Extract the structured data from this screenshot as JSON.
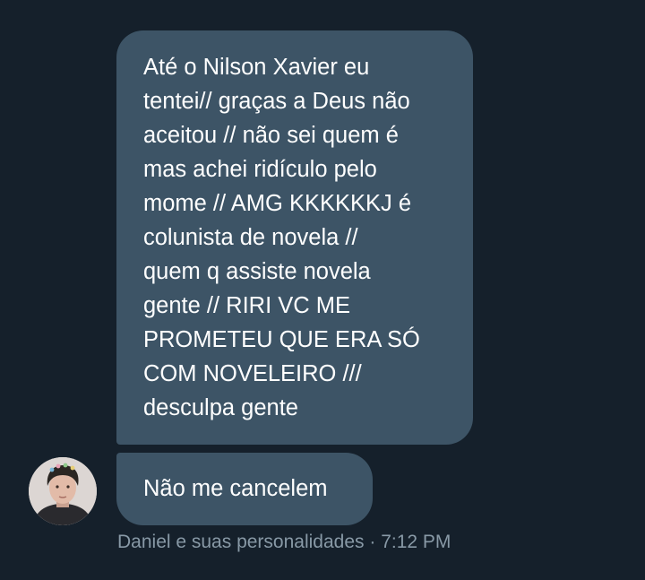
{
  "messages": [
    {
      "lines": [
        "Até o Nilson Xavier eu",
        "tentei// graças a Deus não",
        "aceitou // não sei quem é",
        "mas achei ridículo pelo",
        "mome // AMG KKKKKKJ é",
        "colunista de novela //",
        "quem q assiste novela",
        "gente // RIRI VC ME",
        "PROMETEU QUE ERA SÓ",
        "COM NOVELEIRO ///",
        "desculpa gente"
      ]
    },
    {
      "text": "Não me cancelem"
    }
  ],
  "sender": {
    "name": "Daniel e suas personalidades",
    "separator": "·",
    "time": "7:12 PM"
  },
  "colors": {
    "background": "#15202b",
    "bubble": "#3d5466",
    "meta_text": "#8899a6"
  }
}
